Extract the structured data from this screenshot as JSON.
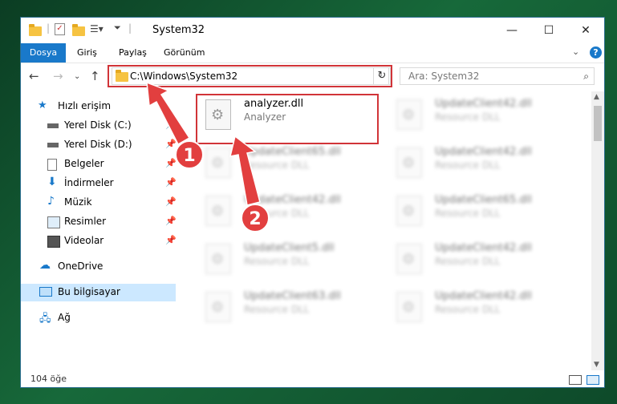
{
  "window": {
    "title": "System32"
  },
  "ribbon": {
    "tabs": [
      "Dosya",
      "Giriş",
      "Paylaş",
      "Görünüm"
    ]
  },
  "address": {
    "path": "C:\\Windows\\System32"
  },
  "search": {
    "placeholder": "Ara: System32"
  },
  "nav": {
    "items": [
      {
        "label": "Hızlı erişim",
        "icon": "star-icon"
      },
      {
        "label": "Yerel Disk (C:)",
        "icon": "drive-icon",
        "pinned": true
      },
      {
        "label": "Yerel Disk (D:)",
        "icon": "drive-icon",
        "pinned": true
      },
      {
        "label": "Belgeler",
        "icon": "documents-icon",
        "pinned": true
      },
      {
        "label": "İndirmeler",
        "icon": "download-icon",
        "pinned": true
      },
      {
        "label": "Müzik",
        "icon": "music-icon",
        "pinned": true
      },
      {
        "label": "Resimler",
        "icon": "pictures-icon",
        "pinned": true
      },
      {
        "label": "Videolar",
        "icon": "videos-icon",
        "pinned": true
      },
      {
        "label": "OneDrive",
        "icon": "cloud-icon"
      },
      {
        "label": "Bu bilgisayar",
        "icon": "computer-icon",
        "selected": true
      },
      {
        "label": "Ağ",
        "icon": "network-icon"
      }
    ]
  },
  "files": [
    {
      "name": "analyzer.dll",
      "desc": "Analyzer"
    },
    {
      "name": "UpdateClient42.dll",
      "desc": "Resource DLL"
    },
    {
      "name": "UpdateClient65.dll",
      "desc": "Resource DLL"
    },
    {
      "name": "UpdateClient42.dll",
      "desc": "Resource DLL"
    },
    {
      "name": "UpdateClient42.dll",
      "desc": "Resource DLL"
    },
    {
      "name": "UpdateClient65.dll",
      "desc": "Resource DLL"
    },
    {
      "name": "UpdateClient5.dll",
      "desc": "Resource DLL"
    },
    {
      "name": "UpdateClient42.dll",
      "desc": "Resource DLL"
    },
    {
      "name": "UpdateClient63.dll",
      "desc": "Resource DLL"
    },
    {
      "name": "UpdateClient42.dll",
      "desc": "Resource DLL"
    }
  ],
  "status": {
    "count": "104 öğe"
  },
  "annotations": {
    "step1": "1",
    "step2": "2"
  },
  "colors": {
    "accent": "#1979ca",
    "highlight": "#d13438",
    "arrow": "#e23f3f"
  }
}
